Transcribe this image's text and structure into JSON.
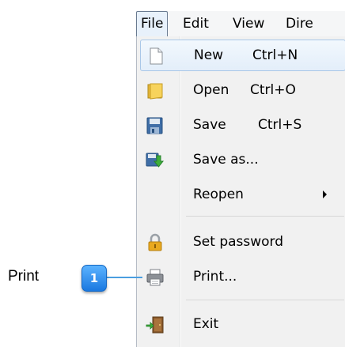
{
  "menubar": {
    "items": [
      {
        "label": "File",
        "active": true
      },
      {
        "label": "Edit"
      },
      {
        "label": "View"
      },
      {
        "label": "Dire"
      }
    ]
  },
  "file_menu": {
    "items": [
      {
        "label": "New",
        "shortcut": "Ctrl+N",
        "icon": "new-document-icon",
        "highlighted": true
      },
      {
        "label": "Open",
        "shortcut": "Ctrl+O",
        "icon": "folder-open-icon"
      },
      {
        "label": "Save",
        "shortcut": "Ctrl+S",
        "icon": "floppy-disk-icon"
      },
      {
        "label": "Save as...",
        "shortcut": "",
        "icon": "save-as-icon"
      },
      {
        "label": "Reopen",
        "shortcut": "",
        "icon": "",
        "submenu": true
      },
      {
        "label": "Set password",
        "shortcut": "",
        "icon": "padlock-icon"
      },
      {
        "label": "Print...",
        "shortcut": "",
        "icon": "printer-icon"
      },
      {
        "label": "Exit",
        "shortcut": "",
        "icon": "exit-door-icon"
      }
    ]
  },
  "callout": {
    "label": "Print",
    "number": "1",
    "color": "#2b8de8"
  }
}
